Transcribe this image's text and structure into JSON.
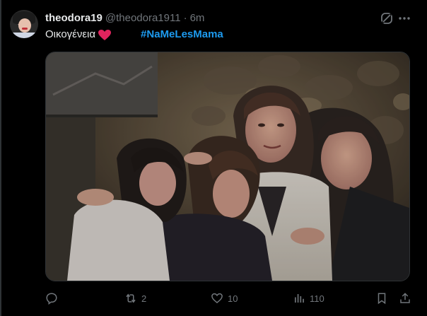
{
  "post": {
    "display_name": "theodora19",
    "handle": "@theodora1911",
    "separator": "·",
    "time": "6m",
    "text": "Οικογένεια",
    "hashtag": "#NaMeLesMama"
  },
  "media": {
    "kind": "photo"
  },
  "actions": {
    "reply_count": "",
    "repost_count": "2",
    "like_count": "10",
    "views_count": "110"
  },
  "icons": {
    "grok": "grok-icon",
    "more": "more-icon",
    "reply": "reply-icon",
    "repost": "repost-icon",
    "like": "heart-icon",
    "views": "views-icon",
    "bookmark": "bookmark-icon",
    "share": "share-icon"
  },
  "colors": {
    "background": "#000000",
    "text": "#e7e9ea",
    "muted": "#71767b",
    "accent": "#1d9bf0",
    "heart": "#e0245e"
  }
}
